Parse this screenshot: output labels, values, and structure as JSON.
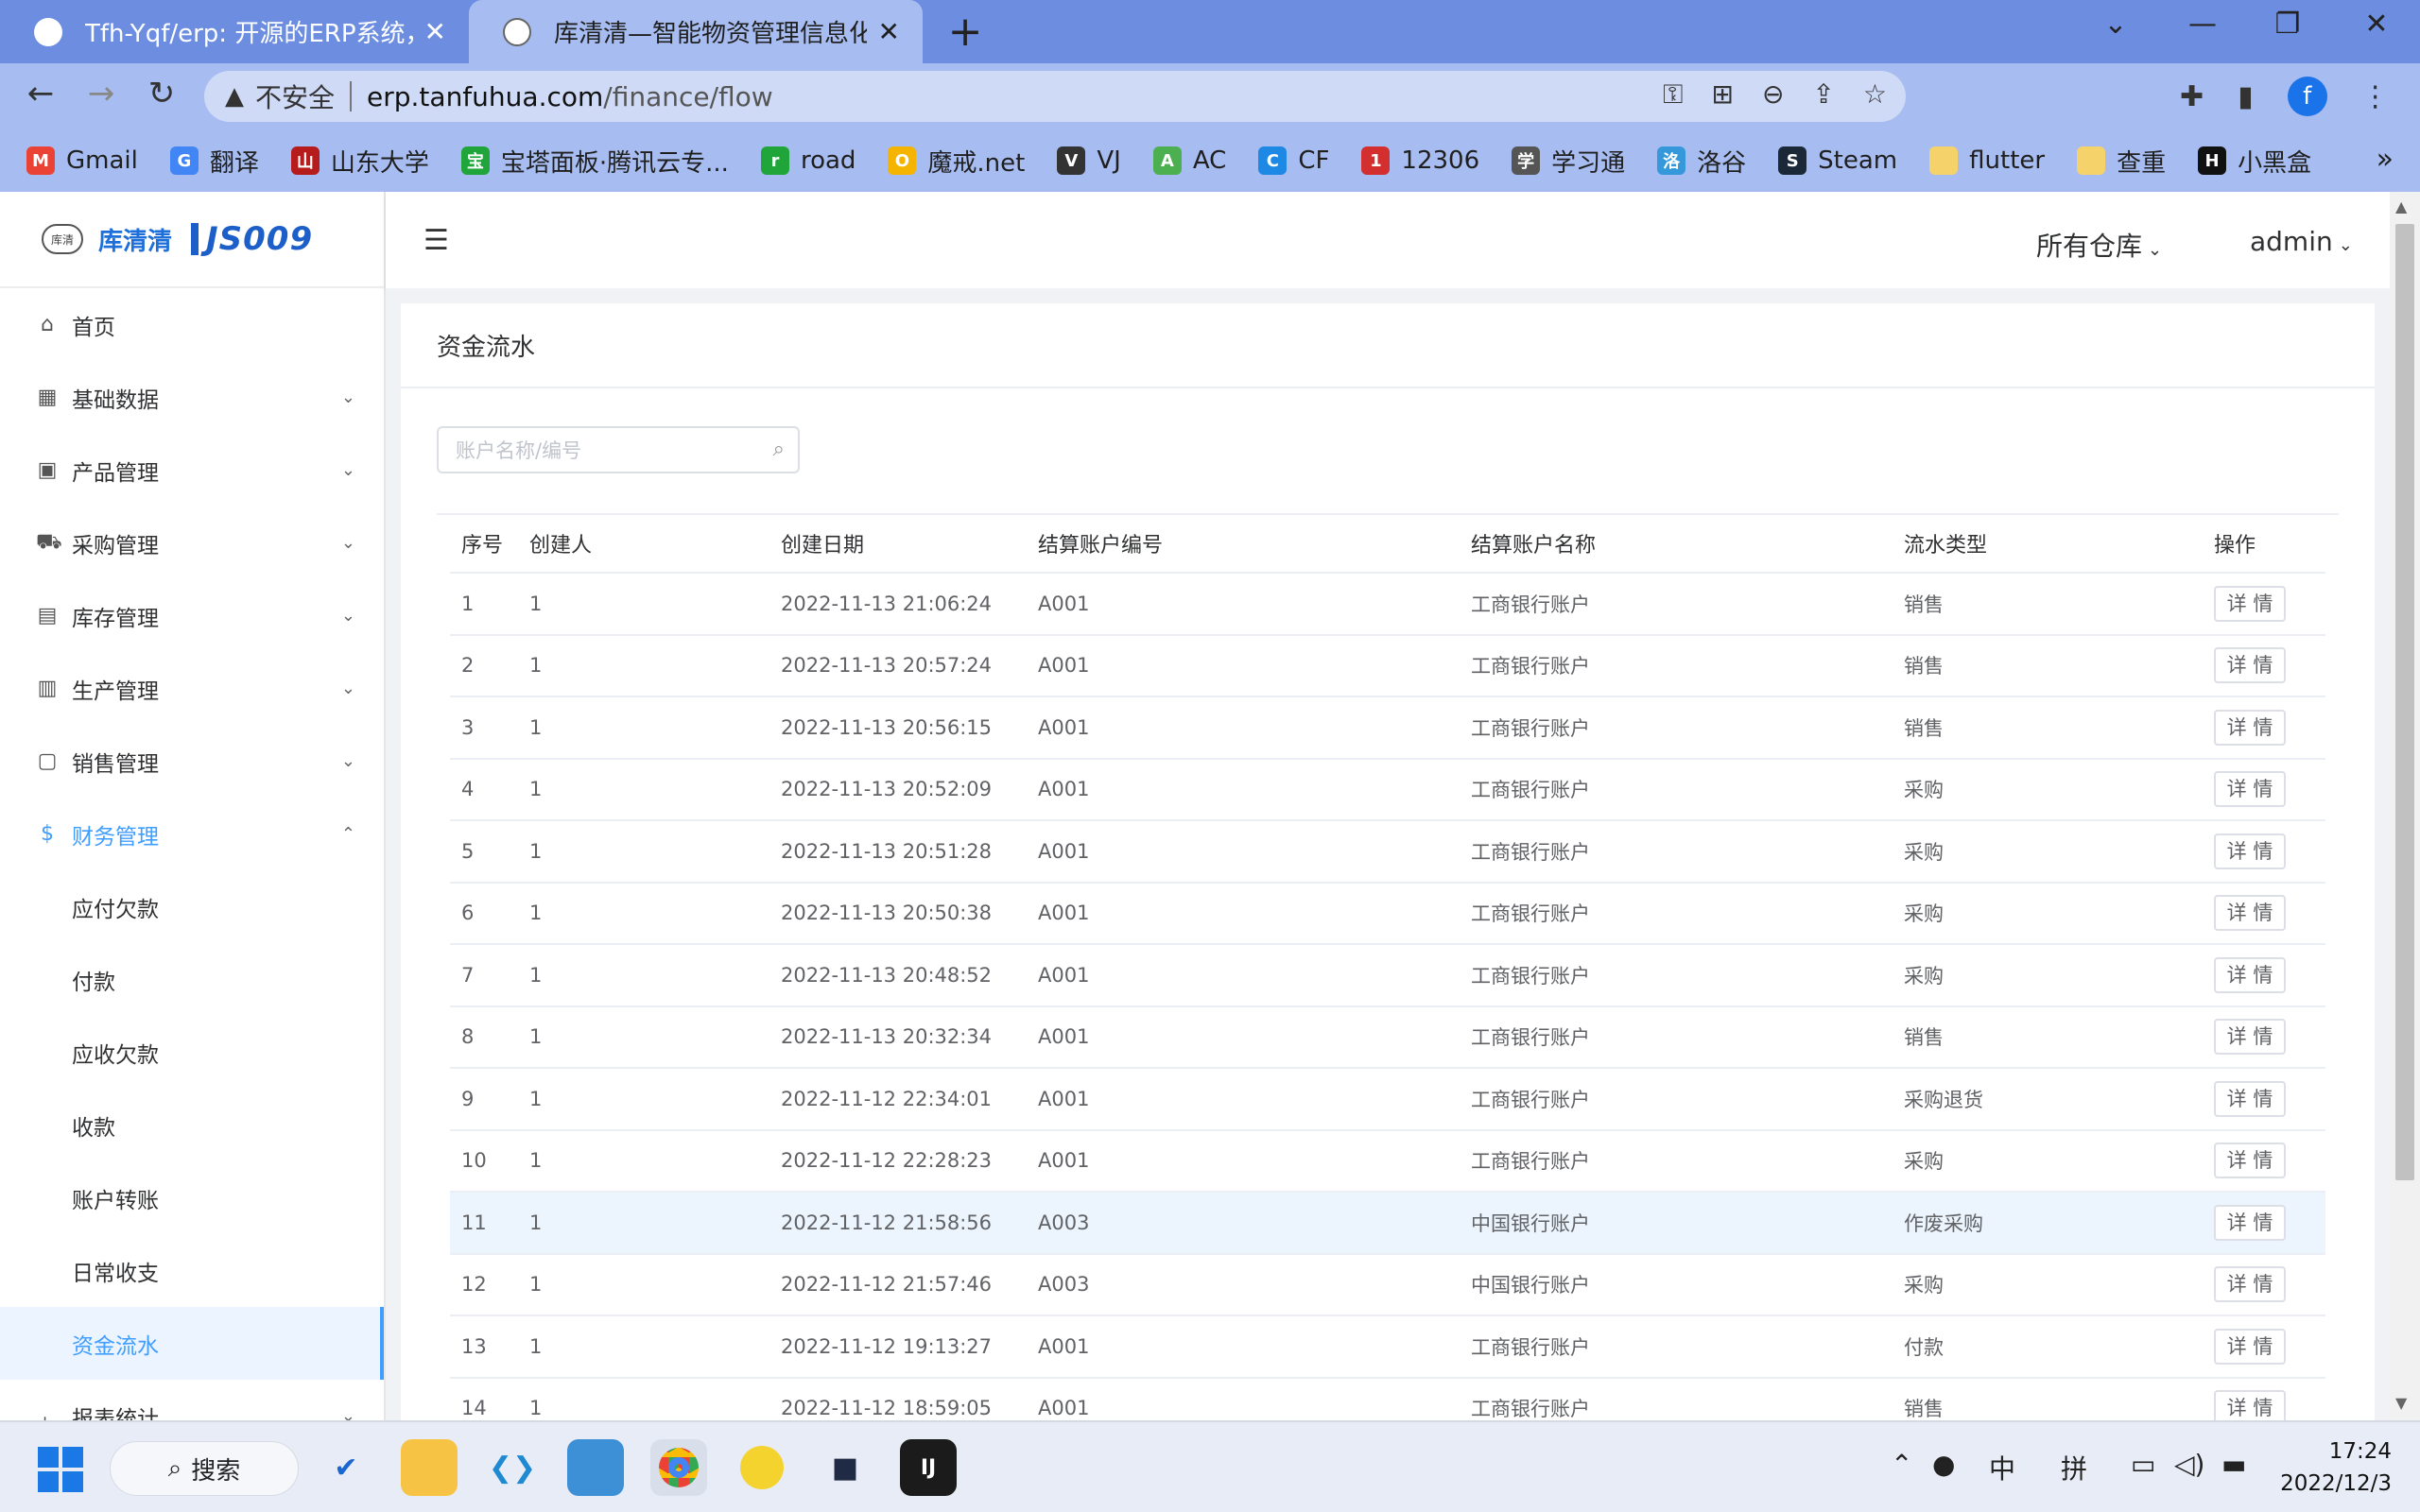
{
  "browser": {
    "tabs": [
      {
        "title": "Tfh-Yqf/erp: 开源的ERP系统，使",
        "close": "✕"
      },
      {
        "title": "库清清—智能物资管理信息化平台",
        "close": "✕"
      }
    ],
    "new_tab": "+",
    "address": {
      "insecure_label": "不安全",
      "host": "erp.tanfuhua.com",
      "path": "/finance/flow"
    },
    "profile_initial": "f",
    "bookmarks": [
      {
        "label": "Gmail",
        "color": "#ea4335",
        "glyph": "M"
      },
      {
        "label": "翻译",
        "color": "#4285f4",
        "glyph": "G"
      },
      {
        "label": "山东大学",
        "color": "#b71c1c",
        "glyph": "山"
      },
      {
        "label": "宝塔面板·腾讯云专...",
        "color": "#20a53a",
        "glyph": "宝"
      },
      {
        "label": "road",
        "color": "#20a53a",
        "glyph": "r"
      },
      {
        "label": "魔戒.net",
        "color": "#f4b400",
        "glyph": "O"
      },
      {
        "label": "VJ",
        "color": "#333333",
        "glyph": "V"
      },
      {
        "label": "AC",
        "color": "#4caf50",
        "glyph": "A"
      },
      {
        "label": "CF",
        "color": "#1e88e5",
        "glyph": "C"
      },
      {
        "label": "12306",
        "color": "#d32f2f",
        "glyph": "1"
      },
      {
        "label": "学习通",
        "color": "#555555",
        "glyph": "学"
      },
      {
        "label": "洛谷",
        "color": "#3498db",
        "glyph": "洛"
      },
      {
        "label": "Steam",
        "color": "#1b2838",
        "glyph": "S"
      },
      {
        "label": "flutter",
        "color": "#f6d36a",
        "glyph": ""
      },
      {
        "label": "查重",
        "color": "#f6d36a",
        "glyph": ""
      },
      {
        "label": "小黑盒",
        "color": "#111111",
        "glyph": "H"
      }
    ],
    "more": "»"
  },
  "app": {
    "logo_text": "库清清",
    "logo_js": "JS009",
    "logo_mark": "库清",
    "header": {
      "warehouse_label": "所有仓库",
      "user_label": "admin"
    },
    "sidebar": [
      {
        "label": "首页",
        "icon": "home-icon",
        "glyph": "⌂",
        "chev": ""
      },
      {
        "label": "基础数据",
        "icon": "grid-icon",
        "glyph": "▦",
        "chev": "⌄"
      },
      {
        "label": "产品管理",
        "icon": "apps-icon",
        "glyph": "▣",
        "chev": "⌄"
      },
      {
        "label": "采购管理",
        "icon": "cart-icon",
        "glyph": "⛟",
        "chev": "⌄"
      },
      {
        "label": "库存管理",
        "icon": "document-icon",
        "glyph": "▤",
        "chev": "⌄"
      },
      {
        "label": "生产管理",
        "icon": "calendar-icon",
        "glyph": "▥",
        "chev": "⌄"
      },
      {
        "label": "销售管理",
        "icon": "bag-icon",
        "glyph": "▢",
        "chev": "⌄"
      },
      {
        "label": "财务管理",
        "icon": "money-icon",
        "glyph": "$",
        "chev": "⌃"
      }
    ],
    "finance_sub": [
      "应付欠款",
      "付款",
      "应收欠款",
      "收款",
      "账户转账",
      "日常收支",
      "资金流水"
    ],
    "next_menu": {
      "label": "报表统计",
      "glyph": "⌞",
      "chev": "⌄"
    },
    "page": {
      "title": "资金流水",
      "search_placeholder": "账户名称/编号",
      "columns": [
        "序号",
        "创建人",
        "创建日期",
        "结算账户编号",
        "结算账户名称",
        "流水类型",
        "操作"
      ],
      "detail_label": "详 情",
      "rows": [
        {
          "no": "1",
          "creator": "1",
          "date": "2022-11-13 21:06:24",
          "code": "A001",
          "name": "工商银行账户",
          "type": "销售"
        },
        {
          "no": "2",
          "creator": "1",
          "date": "2022-11-13 20:57:24",
          "code": "A001",
          "name": "工商银行账户",
          "type": "销售"
        },
        {
          "no": "3",
          "creator": "1",
          "date": "2022-11-13 20:56:15",
          "code": "A001",
          "name": "工商银行账户",
          "type": "销售"
        },
        {
          "no": "4",
          "creator": "1",
          "date": "2022-11-13 20:52:09",
          "code": "A001",
          "name": "工商银行账户",
          "type": "采购"
        },
        {
          "no": "5",
          "creator": "1",
          "date": "2022-11-13 20:51:28",
          "code": "A001",
          "name": "工商银行账户",
          "type": "采购"
        },
        {
          "no": "6",
          "creator": "1",
          "date": "2022-11-13 20:50:38",
          "code": "A001",
          "name": "工商银行账户",
          "type": "采购"
        },
        {
          "no": "7",
          "creator": "1",
          "date": "2022-11-13 20:48:52",
          "code": "A001",
          "name": "工商银行账户",
          "type": "采购"
        },
        {
          "no": "8",
          "creator": "1",
          "date": "2022-11-13 20:32:34",
          "code": "A001",
          "name": "工商银行账户",
          "type": "销售"
        },
        {
          "no": "9",
          "creator": "1",
          "date": "2022-11-12 22:34:01",
          "code": "A001",
          "name": "工商银行账户",
          "type": "采购退货"
        },
        {
          "no": "10",
          "creator": "1",
          "date": "2022-11-12 22:28:23",
          "code": "A001",
          "name": "工商银行账户",
          "type": "采购"
        },
        {
          "no": "11",
          "creator": "1",
          "date": "2022-11-12 21:58:56",
          "code": "A003",
          "name": "中国银行账户",
          "type": "作废采购"
        },
        {
          "no": "12",
          "creator": "1",
          "date": "2022-11-12 21:57:46",
          "code": "A003",
          "name": "中国银行账户",
          "type": "采购"
        },
        {
          "no": "13",
          "creator": "1",
          "date": "2022-11-12 19:13:27",
          "code": "A001",
          "name": "工商银行账户",
          "type": "付款"
        },
        {
          "no": "14",
          "creator": "1",
          "date": "2022-11-12 18:59:05",
          "code": "A001",
          "name": "工商银行账户",
          "type": "销售"
        }
      ]
    }
  },
  "taskbar": {
    "search_label": "搜索",
    "ime_lang": "中",
    "ime_mode": "拼",
    "time": "17:24",
    "date": "2022/12/3"
  }
}
